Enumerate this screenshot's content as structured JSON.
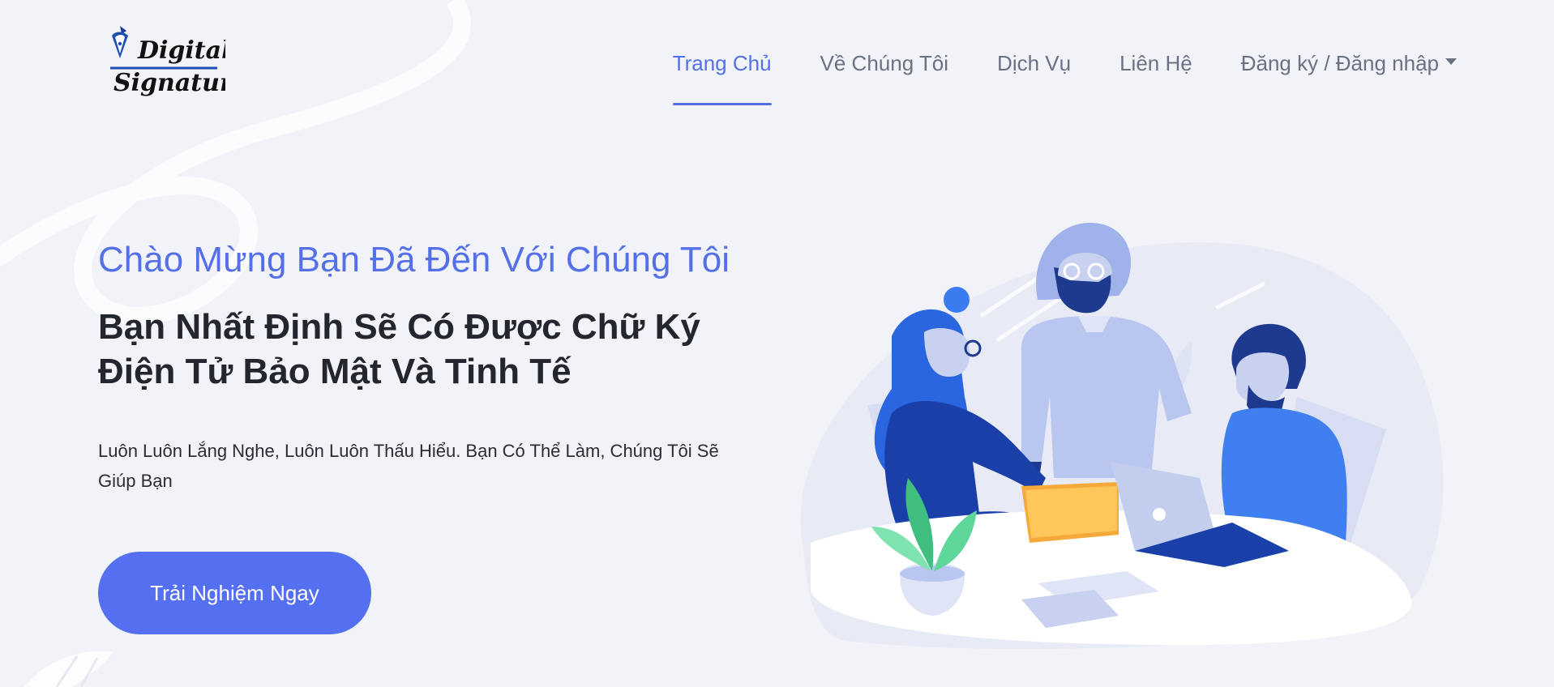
{
  "brand": {
    "logo_line1": "Digital",
    "logo_line2": "Signature"
  },
  "nav": {
    "items": [
      {
        "label": "Trang Chủ",
        "active": true
      },
      {
        "label": "Về Chúng Tôi"
      },
      {
        "label": "Dịch Vụ"
      },
      {
        "label": "Liên Hệ"
      },
      {
        "label": "Đăng ký / Đăng nhập",
        "dropdown": true
      }
    ]
  },
  "hero": {
    "kicker": "Chào Mừng Bạn Đã Đến Với Chúng Tôi",
    "headline": "Bạn Nhất Định Sẽ Có Được Chữ Ký Điện Tử Bảo Mật Và Tinh Tế",
    "lead": "Luôn Luôn Lắng Nghe, Luôn Luôn Thấu Hiểu. Bạn Có Thể Làm, Chúng Tôi Sẽ Giúp Bạn",
    "cta": "Trải Nghiệm Ngay"
  },
  "colors": {
    "accent": "#5470e8",
    "button": "#5470f0",
    "background": "#f2f3f9"
  },
  "icons": {
    "logo": "pen-nib-icon",
    "dropdown": "caret-down-icon",
    "illustration": "team-meeting-illustration"
  }
}
